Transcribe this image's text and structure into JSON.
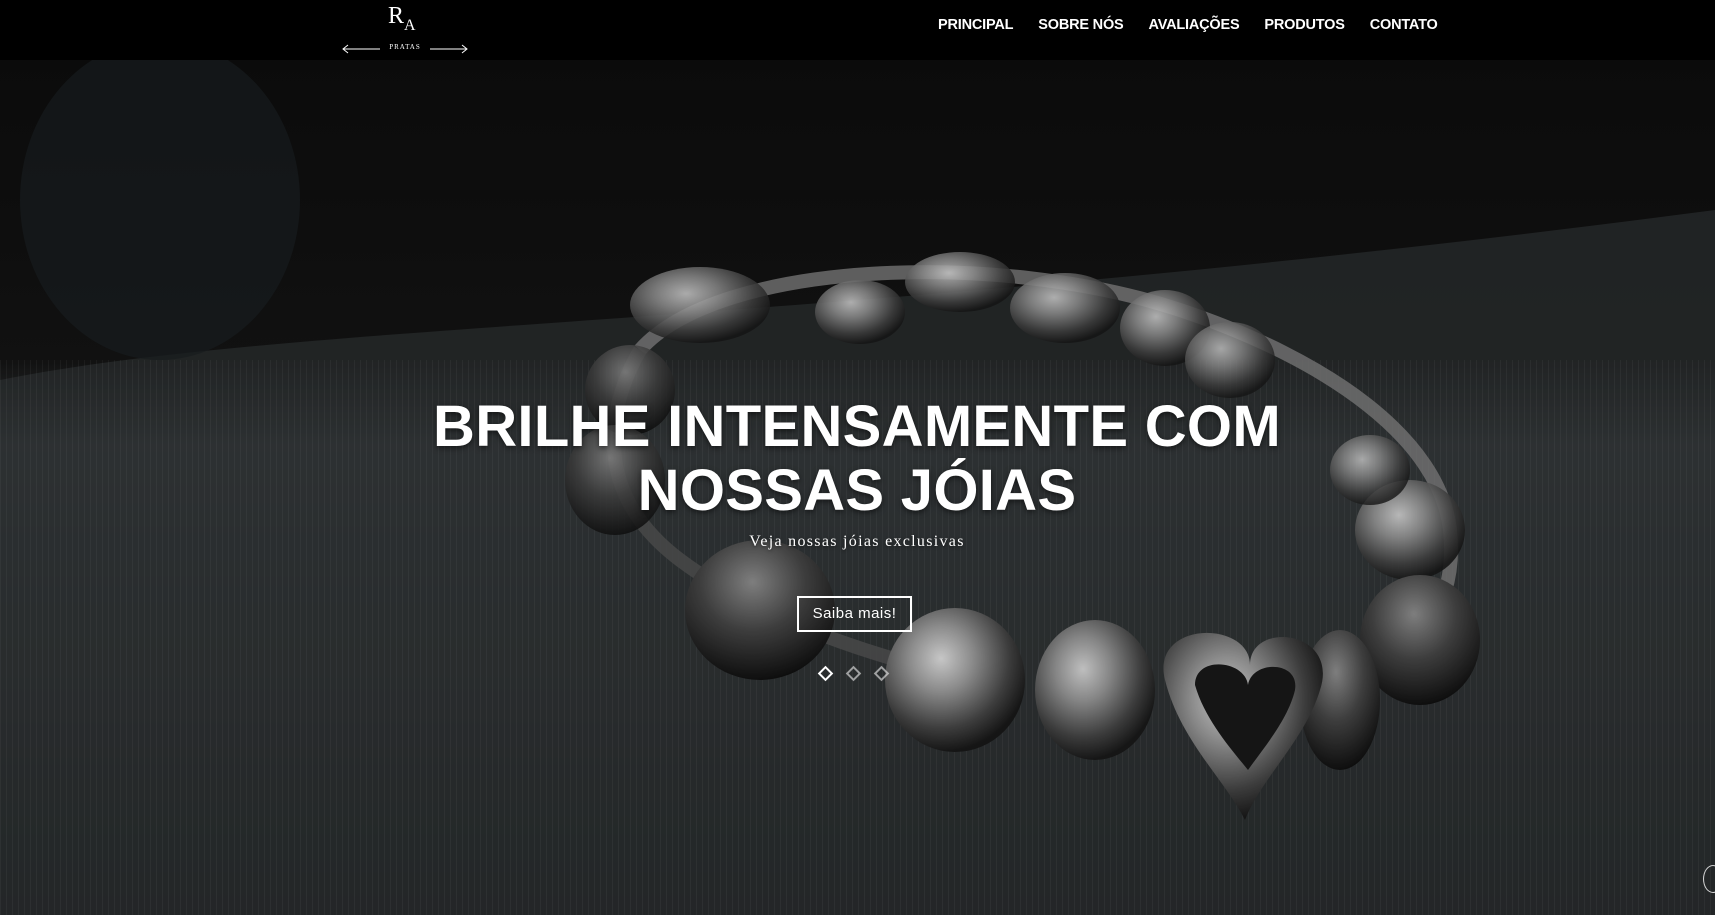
{
  "brand": {
    "logo_letters_r": "R",
    "logo_letters_a": "A",
    "logo_sub": "PRATAS"
  },
  "nav": {
    "items": [
      {
        "label": "PRINCIPAL"
      },
      {
        "label": "SOBRE NÓS"
      },
      {
        "label": "AVALIAÇÕES"
      },
      {
        "label": "PRODUTOS"
      },
      {
        "label": "CONTATO"
      }
    ]
  },
  "hero": {
    "title_line1": "BRILHE INTENSAMENTE COM",
    "title_line2": "NOSSAS JÓIAS",
    "subtitle": "Veja nossas jóias exclusivas",
    "cta_label": "Saiba mais!",
    "slides_total": 3,
    "active_slide": 1
  },
  "colors": {
    "navbar_bg": "#000000",
    "text": "#ffffff",
    "hero_bg": "#2b2e30"
  }
}
